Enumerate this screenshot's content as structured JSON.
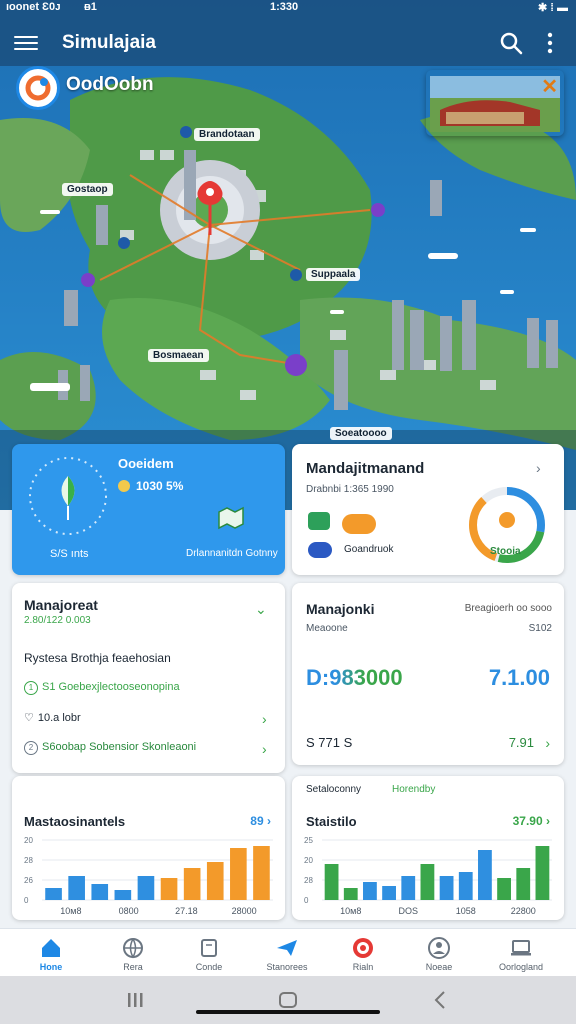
{
  "status_bar": {
    "left": "ıoonet Ɛ0ᴊ",
    "signal": "ᴃ1",
    "time": "1:330",
    "right": "✱ ⁞ ▬"
  },
  "app_bar": {
    "title": "Simulajaia",
    "brand": "OodOobn"
  },
  "map": {
    "pip_close": "✕",
    "labels": [
      "Brandotaan",
      "Gostaop",
      "Suppaala",
      "Bosmaean",
      "Soeatoooo"
    ]
  },
  "cards": {
    "weather": {
      "title": "Ooeidem",
      "value": "1030 5%",
      "bottom_left": "S/S ınts",
      "bottom_right": "Drlannanitdn Gotnny"
    },
    "management_top": {
      "title": "Mandajitmanand",
      "subtitle": "Drabnbi 1:365 1990",
      "badge_label": "Goandruok",
      "ring_label": "Stooia"
    },
    "management_left": {
      "title": "Manajoreat",
      "subtitle": "2.80/122 0.003",
      "heading": "Rystesa Brothja feaehosian",
      "items": [
        {
          "icon": "1",
          "text": "S1 Goebexjlectooseonopina"
        },
        {
          "icon": "♡",
          "text": "10.a lobr"
        },
        {
          "icon": "2",
          "text": "S6oobap Sobensior Skonleaoni"
        }
      ]
    },
    "management_right": {
      "title": "Manajonki",
      "right_title": "Breagioerh oo sooo",
      "sub_left": "Meaoone",
      "sub_right": "S102",
      "big_left": "D:983000",
      "big_right": "7.1.00",
      "foot_left": "S 771 S",
      "foot_right": "7.91"
    },
    "stats_left": {
      "title": "Mastaosinantels",
      "value": "89",
      "x_labels": [
        "10ᴍ8",
        "0800",
        "27.18",
        "28000"
      ],
      "y_labels": [
        "20",
        "28",
        "26",
        "0"
      ]
    },
    "stats_right": {
      "top_left": "Setaloconny",
      "top_right": "Horendby",
      "title": "Staistilo",
      "value": "37.90",
      "x_labels": [
        "10ᴍ8",
        "DOS",
        "1058",
        "22800"
      ],
      "y_labels": [
        "25",
        "20",
        "28",
        "0"
      ]
    }
  },
  "chart_data": [
    {
      "type": "bar",
      "title": "Mastaosinantels",
      "ylim": [
        0,
        30
      ],
      "series": [
        {
          "values": [
            6,
            12,
            8,
            5,
            12,
            11,
            16,
            19,
            26,
            27
          ]
        }
      ]
    },
    {
      "type": "bar",
      "title": "Staistilo",
      "ylim": [
        0,
        30
      ],
      "series": [
        {
          "values": [
            18,
            6,
            9,
            7,
            12,
            18,
            12,
            14,
            25,
            11,
            16,
            27
          ]
        }
      ]
    }
  ],
  "colors": {
    "accent": "#1e88e5",
    "green": "#3aa64a",
    "orange": "#f39a2a",
    "blue_bar": "#2f8fe0"
  },
  "bottom_nav": [
    {
      "label": "Hone",
      "icon": "home-icon",
      "active": true
    },
    {
      "label": "Rera",
      "icon": "globe-icon",
      "active": false
    },
    {
      "label": "Conde",
      "icon": "book-icon",
      "active": false
    },
    {
      "label": "Stanorees",
      "icon": "plane-icon",
      "active": false
    },
    {
      "label": "Rialn",
      "icon": "target-icon",
      "active": false
    },
    {
      "label": "Noeae",
      "icon": "person-icon",
      "active": false
    },
    {
      "label": "Oorlogland",
      "icon": "laptop-icon",
      "active": false
    }
  ]
}
